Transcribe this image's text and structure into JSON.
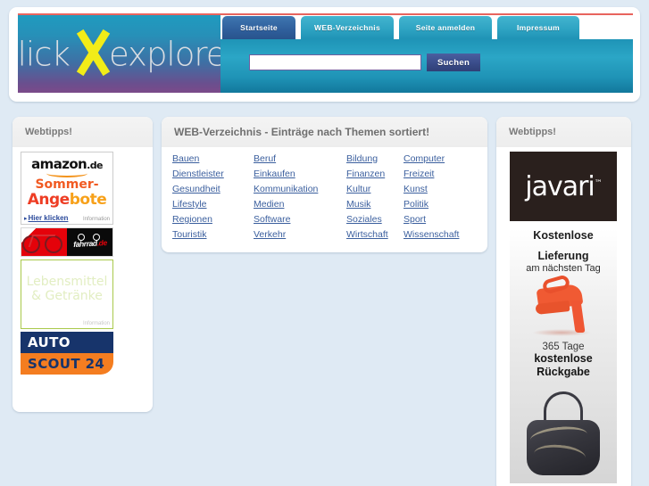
{
  "site": {
    "logo_text_left": "click",
    "logo_text_right": "explorer",
    "logo_x": "X"
  },
  "nav": {
    "tabs": [
      {
        "label": "Startseite",
        "active": true
      },
      {
        "label": "WEB-Verzeichnis",
        "active": false
      },
      {
        "label": "Seite anmelden",
        "active": false
      },
      {
        "label": "Impressum",
        "active": false
      }
    ]
  },
  "search": {
    "value": "",
    "placeholder": "",
    "button_label": "Suchen"
  },
  "left_sidebar": {
    "title": "Webtipps!",
    "ads": {
      "amazon": {
        "brand": "amazon",
        "brand_tld": ".de",
        "line1": "Sommer-",
        "line2_a": "Ange",
        "line2_b": "bote",
        "cta": "Hier klicken",
        "info": "Information"
      },
      "bike": {
        "logo": "fahrrad",
        "logo_accent": ".de"
      },
      "food": {
        "line1": "Lebensmittel",
        "line2": "& Getränke",
        "info": "Information"
      },
      "autoscout": {
        "line1": "AUTO",
        "line2": "SCOUT 24"
      }
    }
  },
  "main": {
    "title": "WEB-Verzeichnis - Einträge nach Themen sortiert!",
    "categories": [
      "Bauen",
      "Beruf",
      "Bildung",
      "Computer",
      "Dienstleister",
      "Einkaufen",
      "Finanzen",
      "Freizeit",
      "Gesundheit",
      "Kommunikation",
      "Kultur",
      "Kunst",
      "Lifestyle",
      "Medien",
      "Musik",
      "Politik",
      "Regionen",
      "Software",
      "Soziales",
      "Sport",
      "Touristik",
      "Verkehr",
      "Wirtschaft",
      "Wissenschaft"
    ]
  },
  "right_sidebar": {
    "title": "Webtipps!",
    "ad": {
      "logo": "javari",
      "logo_tm": "™",
      "line1": "Kostenlose",
      "line2": "Lieferung",
      "line3": "am nächsten Tag",
      "line4": "365 Tage",
      "line5": "kostenlose",
      "line6": "Rückgabe"
    }
  },
  "colors": {
    "page_background": "#dfeaf4",
    "header_teal": "#1f93b6",
    "tab_active": "#2f5f9c",
    "tab_inactive": "#2fa4c3",
    "link_blue": "#3b5f9e",
    "top_rule_red": "#e8645e",
    "logo_x_yellow": "#f2ec18"
  }
}
